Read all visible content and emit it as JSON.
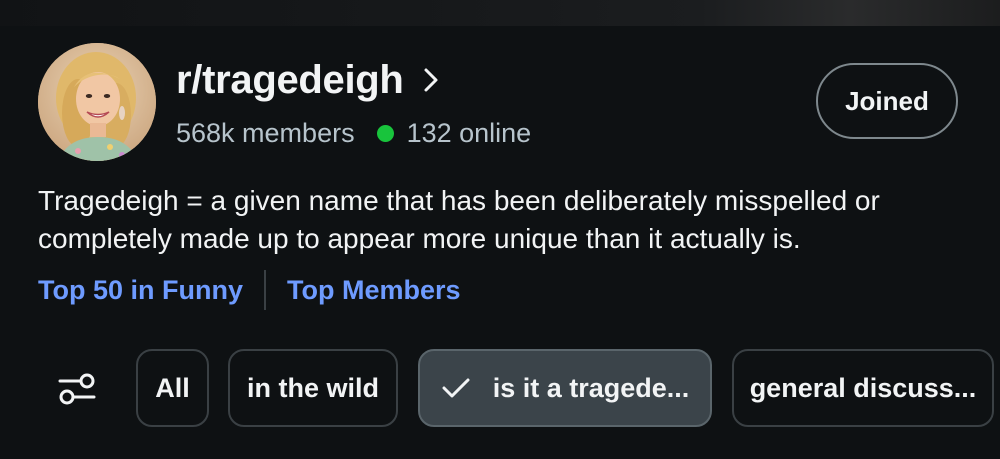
{
  "subreddit": {
    "name": "r/tragedeigh",
    "members": "568k members",
    "online": "132 online",
    "join_button": "Joined",
    "description": "Tragedeigh = a given name that has been deliberately misspelled or completely made up to appear more unique than it actually is.",
    "avatar_icon": "avatar-photo",
    "online_color": "#18c43c"
  },
  "links": [
    {
      "label": "Top 50 in Funny"
    },
    {
      "label": "Top Members"
    }
  ],
  "filters": {
    "icon": "sliders-icon",
    "chips": [
      {
        "label": "All",
        "selected": false
      },
      {
        "label": "in the wild",
        "selected": false
      },
      {
        "label": "is it a tragede...",
        "selected": true
      },
      {
        "label": "general discuss...",
        "selected": false
      }
    ]
  },
  "colors": {
    "background": "#0e1113",
    "link": "#6e9bff",
    "chip_active": "#3b444a"
  }
}
